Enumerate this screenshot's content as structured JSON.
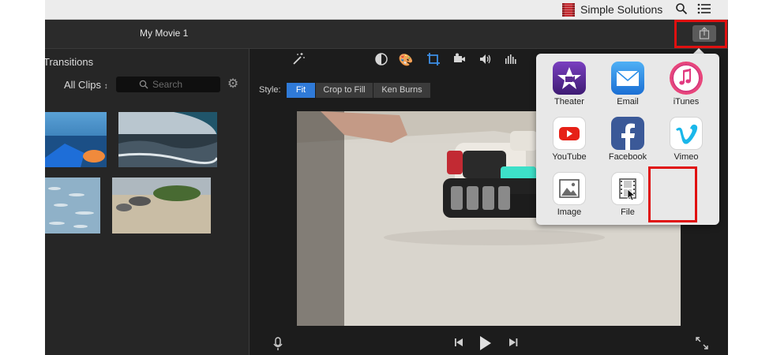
{
  "menubar": {
    "brand": "Simple Solutions",
    "icons": [
      "search-icon",
      "list-icon"
    ]
  },
  "titlebar": {
    "title": "My Movie 1"
  },
  "library": {
    "transitions_label": "Transitions",
    "filter_label": "All Clips",
    "search_placeholder": "Search"
  },
  "viewer": {
    "style_label": "Style:",
    "style_options": [
      "Fit",
      "Crop to Fill",
      "Ken Burns"
    ],
    "selected_style": "Fit"
  },
  "share_menu": {
    "items": [
      "Theater",
      "Email",
      "iTunes",
      "YouTube",
      "Facebook",
      "Vimeo",
      "Image",
      "File"
    ],
    "highlighted": "File"
  },
  "colors": {
    "accent": "#2f7ad8",
    "highlight": "#e01010",
    "theater": "#5b2b91",
    "email": "#2c8fe8",
    "youtube_red": "#e62117",
    "facebook": "#3b5998",
    "vimeo": "#1ab7ea"
  }
}
